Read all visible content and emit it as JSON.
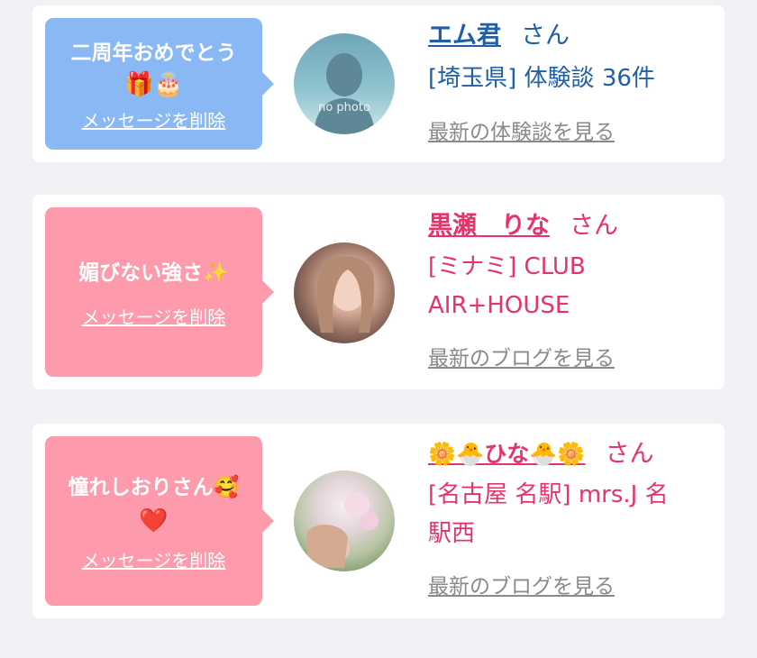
{
  "cards": [
    {
      "bubble_lines": [
        "二周年おめでとう",
        "🎁🎂"
      ],
      "delete_label": "メッセージを削除",
      "avatar_type": "no-photo",
      "avatar_text": "no photo",
      "name": "エム君",
      "suffix": "さん",
      "shop_lines": [
        "[埼玉県] 体験談 36件"
      ],
      "latest_label": "最新の体験談を見る",
      "accent_color": "#1f5ea9",
      "bubble_color": "#8ab8f4"
    },
    {
      "bubble_lines": [
        "媚びない強さ✨"
      ],
      "delete_label": "メッセージを削除",
      "avatar_type": "photo",
      "name": "黒瀬　りな",
      "suffix": "さん",
      "shop_lines": [
        "[ミナミ] CLUB",
        "AIR+HOUSE"
      ],
      "latest_label": "最新のブログを見る",
      "accent_color": "#e8336a",
      "bubble_color": "#fd9aac"
    },
    {
      "bubble_lines": [
        "憧れしおりさん🥰",
        "❤️"
      ],
      "delete_label": "メッセージを削除",
      "avatar_type": "photo",
      "name": "🌼🐣ひな🐣🌼",
      "suffix": "さん",
      "shop_lines": [
        "[名古屋 名駅] mrs.J 名",
        "駅西"
      ],
      "latest_label": "最新のブログを見る",
      "accent_color": "#e8336a",
      "bubble_color": "#fd9aac"
    }
  ]
}
